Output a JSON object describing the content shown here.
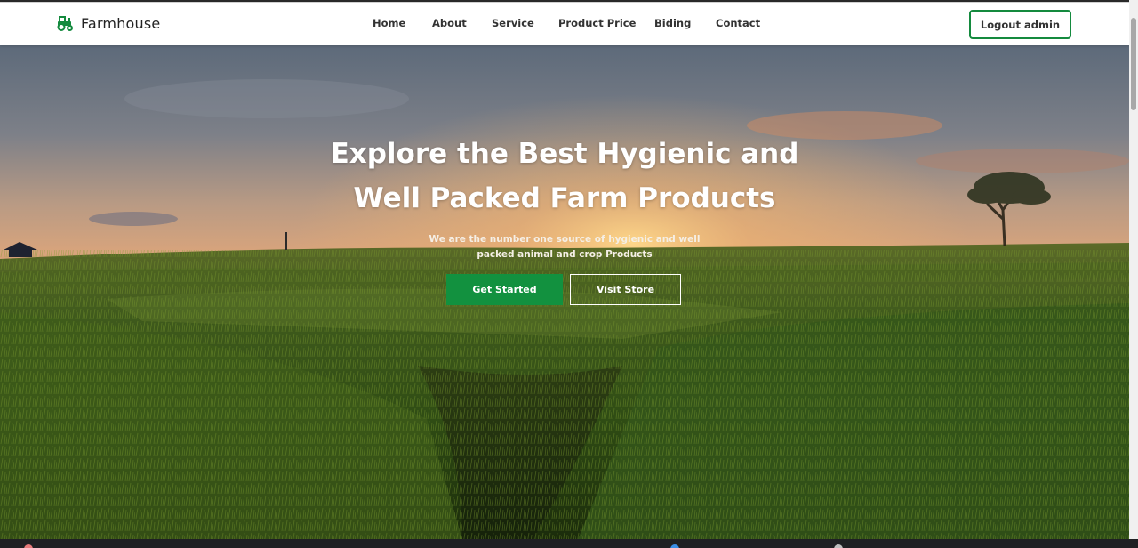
{
  "brand": {
    "name": "Farmhouse",
    "icon": "tractor-icon",
    "color": "#148a3e"
  },
  "nav": {
    "links": [
      "Home",
      "About",
      "Service",
      "Product Price",
      "Biding",
      "Contact"
    ],
    "logout_label": "Logout admin"
  },
  "hero": {
    "title_line1": "Explore the Best Hygienic and",
    "title_line2": "Well Packed Farm Products",
    "subtitle_line1": "We are the number one source of hygienic and well",
    "subtitle_line2": "packed animal and crop Products",
    "primary_button": "Get Started",
    "secondary_button": "Visit Store",
    "background": "sunset-rice-field-image"
  },
  "colors": {
    "accent": "#12913f",
    "navbar_bg": "#ffffff"
  }
}
